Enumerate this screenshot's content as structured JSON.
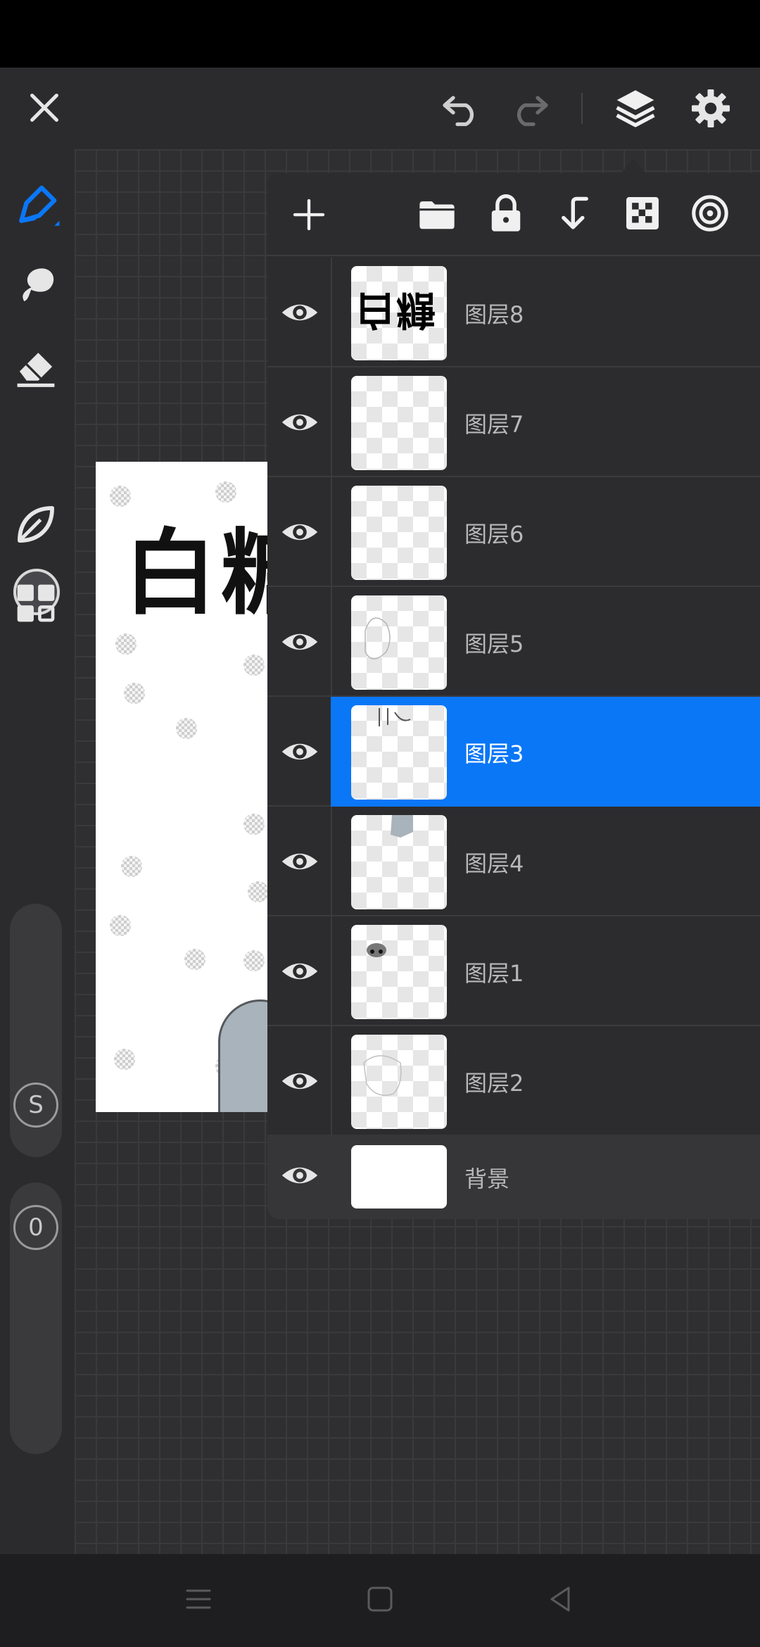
{
  "app": {
    "accent_color": "#0a77f7",
    "top_bar": {
      "close_icon": "close-icon",
      "undo_icon": "undo-icon",
      "redo_icon": "redo-icon",
      "layers_icon": "layers-icon",
      "settings_icon": "gear-icon"
    }
  },
  "left_toolbar": {
    "tools": [
      "brush",
      "smudge",
      "eraser",
      "color",
      "leaf-brush",
      "grid"
    ],
    "color_swatch": "#48484c",
    "size_badge": "S",
    "opacity_badge": "0"
  },
  "artwork": {
    "title_text": "白糖"
  },
  "layers_panel": {
    "toolbar": [
      "add-layer",
      "folder",
      "lock",
      "merge-down",
      "alpha-lock",
      "clipping-target"
    ],
    "layers": [
      {
        "name": "图层8",
        "visible": true,
        "selected": false,
        "thumb_text": "白糖"
      },
      {
        "name": "图层7",
        "visible": true,
        "selected": false
      },
      {
        "name": "图层6",
        "visible": true,
        "selected": false
      },
      {
        "name": "图层5",
        "visible": true,
        "selected": false
      },
      {
        "name": "图层3",
        "visible": true,
        "selected": true
      },
      {
        "name": "图层4",
        "visible": true,
        "selected": false
      },
      {
        "name": "图层1",
        "visible": true,
        "selected": false
      },
      {
        "name": "图层2",
        "visible": true,
        "selected": false
      }
    ],
    "background_layer": {
      "name": "背景",
      "visible": true
    }
  },
  "nav_bar": {
    "menu_icon": "menu-icon",
    "home_icon": "home-icon",
    "back_icon": "back-icon"
  }
}
